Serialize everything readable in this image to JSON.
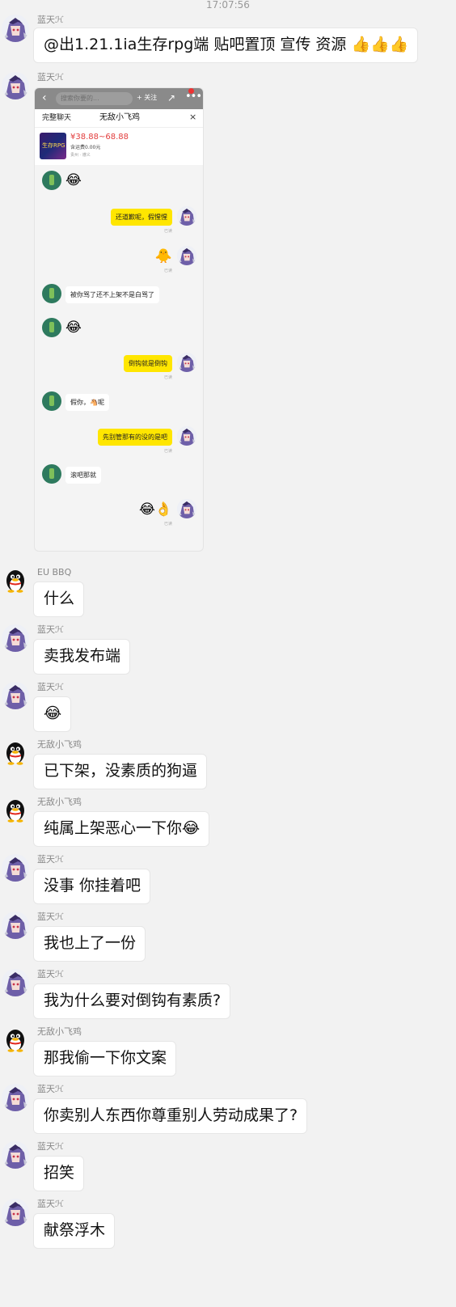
{
  "timestamp": "17:07:56",
  "messages": [
    {
      "sender": "蓝天ℋ",
      "avatar": "anime",
      "text": "@出1.21.1ia生存rpg端 贴吧置顶 宣传 资源 👍👍👍"
    },
    {
      "sender": "蓝天ℋ",
      "avatar": "anime",
      "image": true
    },
    {
      "sender": "EU BBQ",
      "avatar": "penguin",
      "text": " 什么"
    },
    {
      "sender": "蓝天ℋ",
      "avatar": "anime",
      "text": "卖我发布端"
    },
    {
      "sender": "蓝天ℋ",
      "avatar": "anime",
      "text": "😂"
    },
    {
      "sender": "无敌小飞鸡",
      "avatar": "penguin",
      "text": "已下架，没素质的狗逼"
    },
    {
      "sender": "无敌小飞鸡",
      "avatar": "penguin",
      "text": "纯属上架恶心一下你😂"
    },
    {
      "sender": "蓝天ℋ",
      "avatar": "anime",
      "text": "没事 你挂着吧"
    },
    {
      "sender": "蓝天ℋ",
      "avatar": "anime",
      "text": "我也上了一份"
    },
    {
      "sender": "蓝天ℋ",
      "avatar": "anime",
      "text": "我为什么要对倒钩有素质?"
    },
    {
      "sender": "无敌小飞鸡",
      "avatar": "penguin",
      "text": "那我偷一下你文案"
    },
    {
      "sender": "蓝天ℋ",
      "avatar": "anime",
      "text": "你卖别人东西你尊重别人劳动成果了?"
    },
    {
      "sender": "蓝天ℋ",
      "avatar": "anime",
      "text": "招笑"
    },
    {
      "sender": "蓝天ℋ",
      "avatar": "anime",
      "text": "献祭浮木"
    }
  ],
  "screenshot": {
    "back_icon": "‹",
    "search_placeholder": "搜索你要的...",
    "follow_label": "+ 关注",
    "share_icon": "↗",
    "more_icon": "•••",
    "full_chat_label": "完整聊天",
    "chat_title": "无敌小飞鸡",
    "close_icon": "×",
    "product": {
      "thumb_text": "生存RPG",
      "price": "¥38.88~68.88",
      "shipping": "含运费0.00元",
      "location": "贵州 · 遵义"
    },
    "read_label": "已读",
    "rows": [
      {
        "side": "left",
        "emoji": "😂"
      },
      {
        "side": "right",
        "text": "还道歉呢，假惺惺"
      },
      {
        "side": "right",
        "emoji": "🐥"
      },
      {
        "side": "left",
        "text": "被你骂了还不上架不是白骂了"
      },
      {
        "side": "left",
        "emoji": "😂"
      },
      {
        "side": "right",
        "text": "倒钩就是倒钩"
      },
      {
        "side": "left",
        "text": "假你，🐴呢"
      },
      {
        "side": "right",
        "text": "先别管那有的没的是吧"
      },
      {
        "side": "left",
        "text": "滚吧那就"
      },
      {
        "side": "right",
        "emoji": "😂👌"
      }
    ]
  }
}
